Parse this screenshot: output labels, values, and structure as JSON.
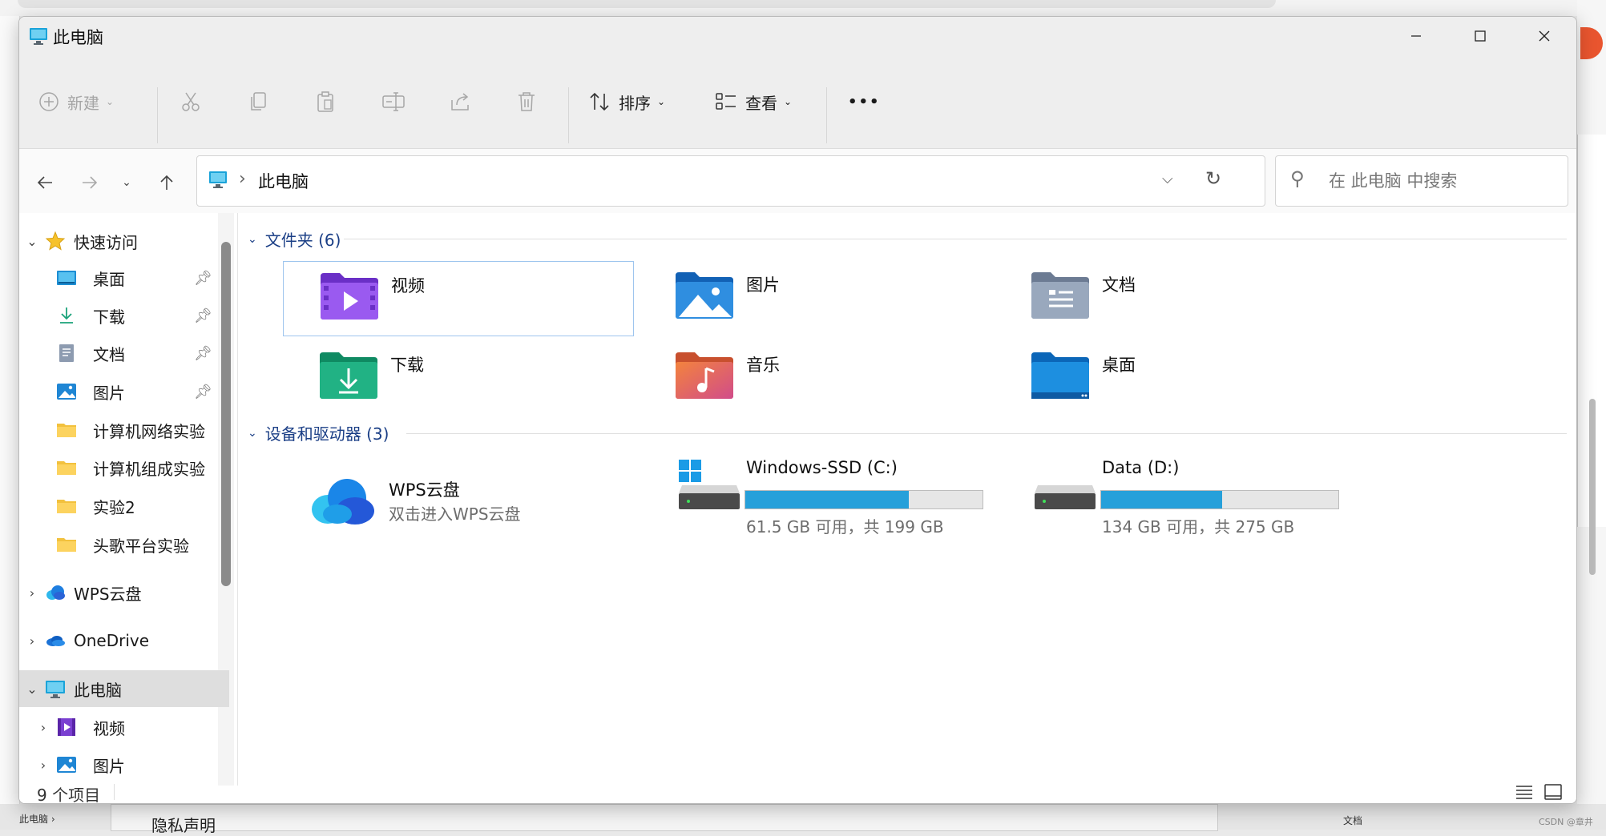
{
  "window": {
    "title": "此电脑"
  },
  "toolbar": {
    "new_label": "新建",
    "sort_label": "排序",
    "view_label": "查看",
    "more_label": "•••"
  },
  "nav": {
    "path": "此电脑"
  },
  "search": {
    "placeholder": "在 此电脑 中搜索"
  },
  "sidebar": {
    "quick_access": "快速访问",
    "items": [
      {
        "label": "桌面",
        "icon": "desktop-icon",
        "pinned": true
      },
      {
        "label": "下载",
        "icon": "download-icon",
        "pinned": true
      },
      {
        "label": "文档",
        "icon": "document-icon",
        "pinned": true
      },
      {
        "label": "图片",
        "icon": "pictures-icon",
        "pinned": true
      },
      {
        "label": "计算机网络实验",
        "icon": "folder-icon",
        "pinned": false
      },
      {
        "label": "计算机组成实验",
        "icon": "folder-icon",
        "pinned": false
      },
      {
        "label": "实验2",
        "icon": "folder-icon",
        "pinned": false
      },
      {
        "label": "头歌平台实验",
        "icon": "folder-icon",
        "pinned": false
      }
    ],
    "wps": "WPS云盘",
    "onedrive": "OneDrive",
    "this_pc": "此电脑",
    "pc_children": [
      {
        "label": "视频",
        "icon": "videos-icon"
      },
      {
        "label": "图片",
        "icon": "pictures-icon"
      }
    ]
  },
  "content": {
    "folders_header": "文件夹 (6)",
    "folders": [
      {
        "label": "视频",
        "icon": "videos-folder-icon"
      },
      {
        "label": "图片",
        "icon": "pictures-folder-icon"
      },
      {
        "label": "文档",
        "icon": "documents-folder-icon"
      },
      {
        "label": "下载",
        "icon": "downloads-folder-icon"
      },
      {
        "label": "音乐",
        "icon": "music-folder-icon"
      },
      {
        "label": "桌面",
        "icon": "desktop-folder-icon"
      }
    ],
    "devices_header": "设备和驱动器 (3)",
    "devices": [
      {
        "name": "WPS云盘",
        "sub": "双击进入WPS云盘",
        "icon": "wps-cloud-icon"
      },
      {
        "name": "Windows-SSD (C:)",
        "sub": "61.5 GB 可用，共 199 GB",
        "used_fraction": 0.69,
        "icon": "windows-drive-icon"
      },
      {
        "name": "Data (D:)",
        "sub": "134 GB 可用，共 275 GB",
        "used_fraction": 0.51,
        "icon": "data-drive-icon"
      }
    ]
  },
  "status": {
    "count": "9 个项目"
  },
  "background": {
    "privacy": "隐私声明",
    "doc_label": "文档",
    "crumb": "此电脑 ›",
    "watermark": "CSDN @章井"
  },
  "colors": {
    "accent": "#26a0da",
    "group_header": "#1b3f86"
  }
}
